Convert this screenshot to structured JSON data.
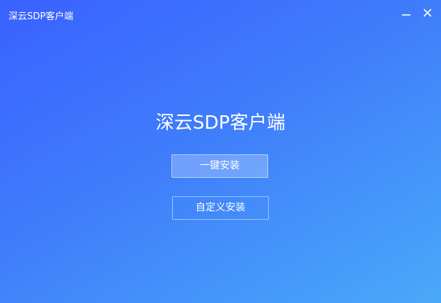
{
  "window": {
    "title": "深云SDP客户端",
    "minimize_icon": "minimize-icon",
    "close_icon": "close-icon"
  },
  "main": {
    "app_title": "深云SDP客户端",
    "one_click_install_label": "一键安装",
    "custom_install_label": "自定义安装"
  },
  "colors": {
    "gradient_start": "#3a61ff",
    "gradient_end": "#4aa9f9",
    "text": "#ffffff"
  }
}
